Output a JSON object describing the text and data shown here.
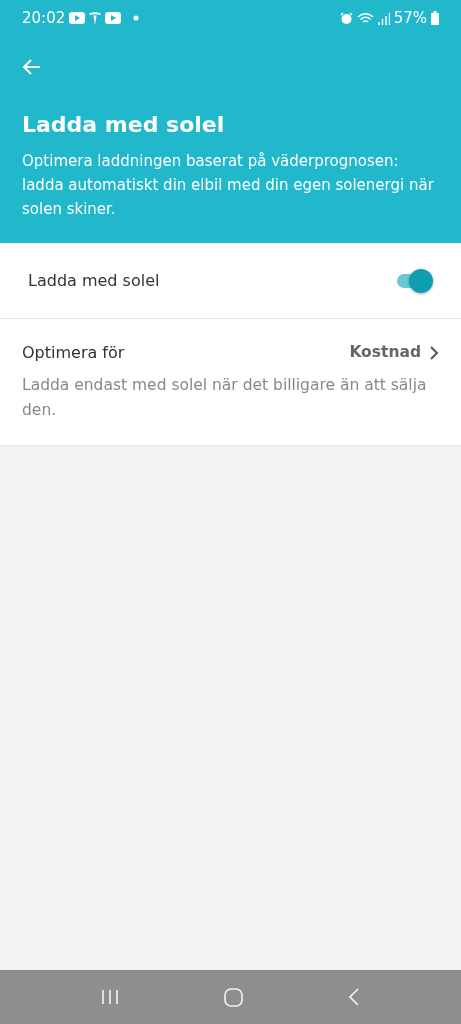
{
  "status_bar": {
    "time": "20:02",
    "battery": "57%"
  },
  "header": {
    "title": "Ladda med solel",
    "description": "Optimera laddningen baserat på väderprognosen: ladda automatiskt din elbil med din egen solenergi när solen skiner."
  },
  "settings": [
    {
      "kind": "toggle",
      "label": "Ladda med solel",
      "on": true
    },
    {
      "kind": "select",
      "label": "Optimera för",
      "value": "Kostnad",
      "description": "Ladda endast med solel när det billigare än att sälja den."
    }
  ]
}
